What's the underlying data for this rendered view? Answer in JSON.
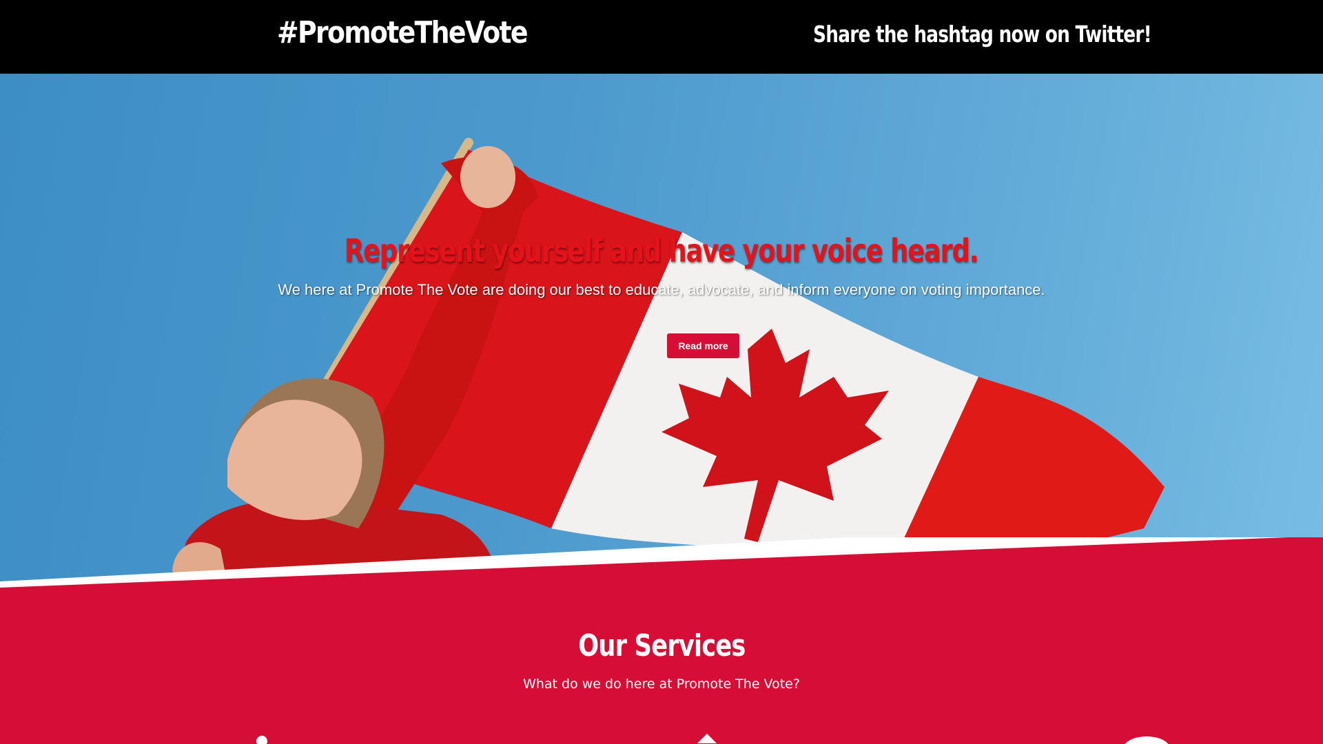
{
  "header": {
    "brand": "#PromoteTheVote",
    "share_link": "Share the hashtag now on Twitter!"
  },
  "hero": {
    "title": "Represent yourself and have your voice heard.",
    "subtitle": "We here at Promote The Vote are doing our best to educate, advocate, and inform everyone on voting importance.",
    "button_label": "Read more"
  },
  "services": {
    "title": "Our Services",
    "subtitle": "What do we do here at Promote The Vote?",
    "icons": [
      "info-icon",
      "home-icon",
      "chat-icon"
    ]
  },
  "colors": {
    "topbar": "#000000",
    "accent_red": "#d60e36",
    "title_red": "#e4121b",
    "sky_blue": "#4c99cd"
  }
}
